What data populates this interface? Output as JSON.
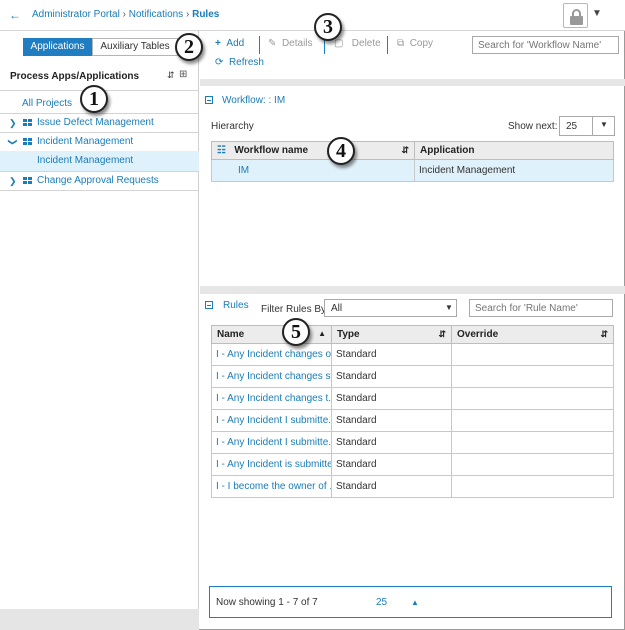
{
  "breadcrumb": {
    "items": [
      "Administrator Portal",
      "Notifications"
    ],
    "separator": "›",
    "current": "Rules"
  },
  "left_panel": {
    "tabs": [
      "Applications",
      "Auxiliary Tables"
    ],
    "title": "Process Apps/Applications",
    "tree": [
      {
        "label": "All Projects",
        "type": "link"
      },
      {
        "label": "Issue Defect Management",
        "expanded": false
      },
      {
        "label": "Incident Management",
        "expanded": true
      },
      {
        "label": "Incident Management",
        "child": true,
        "selected": true
      },
      {
        "label": "Change Approval Requests",
        "expanded": false
      }
    ]
  },
  "toolbar": {
    "add": "Add",
    "details": "Details",
    "delete": "Delete",
    "copy": "Copy",
    "refresh": "Refresh",
    "search_placeholder": "Search for 'Workflow Name'"
  },
  "workflow": {
    "section_title": "Workflow: : IM",
    "hierarchy_label": "Hierarchy",
    "show_next_label": "Show next:",
    "show_next_value": "25",
    "columns": [
      "Workflow name",
      "Application"
    ],
    "rows": [
      {
        "name": "IM",
        "application": "Incident Management"
      }
    ]
  },
  "rules": {
    "section_title": "Rules",
    "filter_label": "Filter Rules By:",
    "filter_value": "All",
    "search_placeholder": "Search for 'Rule Name'",
    "columns": [
      "Name",
      "Type",
      "Override"
    ],
    "rows": [
      {
        "name": "I - Any Incident changes o...",
        "type": "Standard",
        "override": ""
      },
      {
        "name": "I - Any Incident changes st...",
        "type": "Standard",
        "override": ""
      },
      {
        "name": "I - Any Incident changes t...",
        "type": "Standard",
        "override": ""
      },
      {
        "name": "I - Any Incident I submitte...",
        "type": "Standard",
        "override": ""
      },
      {
        "name": "I - Any Incident I submitte...",
        "type": "Standard",
        "override": ""
      },
      {
        "name": "I - Any Incident is submitted",
        "type": "Standard",
        "override": ""
      },
      {
        "name": "I - I become the owner of ...",
        "type": "Standard",
        "override": ""
      }
    ]
  },
  "pager": {
    "text": "Now showing 1 - 7 of 7",
    "page_size": "25"
  },
  "callouts": [
    "1",
    "2",
    "3",
    "4",
    "5"
  ],
  "colors": {
    "accent": "#1f7ec1",
    "link": "#1a7cb8",
    "selected_row": "#dff1fa",
    "header_bg": "#ececec",
    "band": "#e6e6e6"
  }
}
